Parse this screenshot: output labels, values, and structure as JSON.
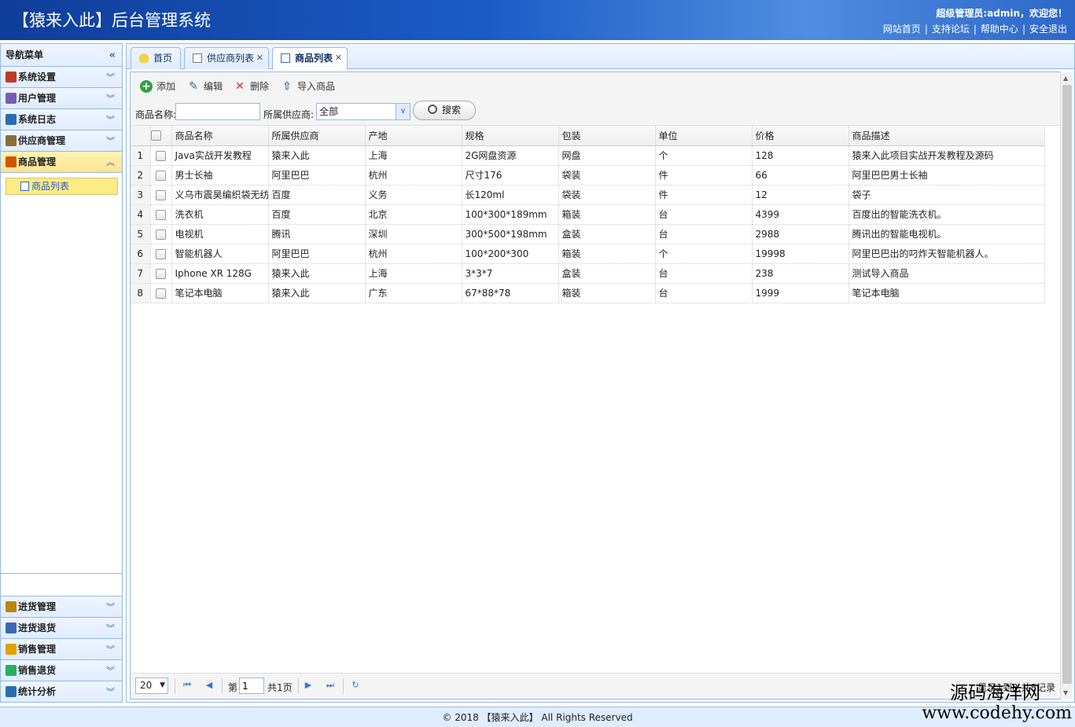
{
  "header": {
    "title": "【猿来入此】后台管理系统",
    "welcome": "超级管理员:admin，欢迎您！",
    "links": [
      "网站首页",
      "支持论坛",
      "帮助中心",
      "安全退出"
    ],
    "separator": "|"
  },
  "sidebar": {
    "title": "导航菜单",
    "collapse_icon": "«",
    "panels": [
      {
        "label": "系统设置",
        "icon": "tools-icon",
        "color": "#c0392b"
      },
      {
        "label": "用户管理",
        "icon": "users-icon",
        "color": "#7b5cb3"
      },
      {
        "label": "系统日志",
        "icon": "log-icon",
        "color": "#2b6cb0"
      },
      {
        "label": "供应商管理",
        "icon": "supplier-icon",
        "color": "#8a6d3b"
      },
      {
        "label": "商品管理",
        "icon": "goods-icon",
        "color": "#d35400",
        "active": true
      }
    ],
    "sub_items": [
      {
        "label": "商品列表",
        "icon": "list-icon"
      }
    ],
    "bottom_panels": [
      {
        "label": "进货管理",
        "icon": "purchase-icon",
        "color": "#b8860b"
      },
      {
        "label": "进货退货",
        "icon": "purchase-return-icon",
        "color": "#3a6ab6"
      },
      {
        "label": "销售管理",
        "icon": "sales-icon",
        "color": "#e1a100"
      },
      {
        "label": "销售退货",
        "icon": "sales-return-icon",
        "color": "#27ae60"
      },
      {
        "label": "统计分析",
        "icon": "chart-icon",
        "color": "#2b6cb0"
      }
    ]
  },
  "tabs": [
    {
      "label": "首页",
      "icon": "bulb-icon",
      "closable": false
    },
    {
      "label": "供应商列表",
      "icon": "card-icon",
      "closable": true
    },
    {
      "label": "商品列表",
      "icon": "list-icon",
      "closable": true,
      "active": true
    }
  ],
  "toolbar": {
    "add": "添加",
    "edit": "编辑",
    "delete": "删除",
    "import": "导入商品"
  },
  "search": {
    "name_label": "商品名称:",
    "name_value": "",
    "supplier_label": "所属供应商:",
    "supplier_value": "全部",
    "button": "搜索"
  },
  "grid": {
    "columns": [
      "商品名称",
      "所属供应商",
      "产地",
      "规格",
      "包装",
      "单位",
      "价格",
      "商品描述"
    ],
    "rows": [
      [
        "1",
        "Java实战开发教程",
        "猿来入此",
        "上海",
        "2G网盘资源",
        "网盘",
        "个",
        "128",
        "猿来入此项目实战开发教程及源码"
      ],
      [
        "2",
        "男士长袖",
        "阿里巴巴",
        "杭州",
        "尺寸176",
        "袋装",
        "件",
        "66",
        "阿里巴巴男士长袖"
      ],
      [
        "3",
        "义乌市震昊编织袋无纺",
        "百度",
        "义务",
        "长120ml",
        "袋装",
        "件",
        "12",
        "袋子"
      ],
      [
        "4",
        "洗衣机",
        "百度",
        "北京",
        "100*300*189mm",
        "箱装",
        "台",
        "4399",
        "百度出的智能洗衣机。"
      ],
      [
        "5",
        "电视机",
        "腾讯",
        "深圳",
        "300*500*198mm",
        "盒装",
        "台",
        "2988",
        "腾讯出的智能电视机。"
      ],
      [
        "6",
        "智能机器人",
        "阿里巴巴",
        "杭州",
        "100*200*300",
        "箱装",
        "个",
        "19998",
        "阿里巴巴出的叼炸天智能机器人。"
      ],
      [
        "7",
        "Iphone XR 128G",
        "猿来入此",
        "上海",
        "3*3*7",
        "盒装",
        "台",
        "238",
        "测试导入商品"
      ],
      [
        "8",
        "笔记本电脑",
        "猿来入此",
        "广东",
        "67*88*78",
        "箱装",
        "台",
        "1999",
        "笔记本电脑"
      ]
    ]
  },
  "pager": {
    "page_size": "20",
    "page_prefix": "第",
    "page_value": "1",
    "page_total": "共1页",
    "info": "显示1到8,共8记录"
  },
  "footer": {
    "text": "© 2018 【猿来入此】 All Rights Reserved"
  },
  "watermark": {
    "line1": "源码海洋网",
    "line2": "www.codehy.com"
  }
}
